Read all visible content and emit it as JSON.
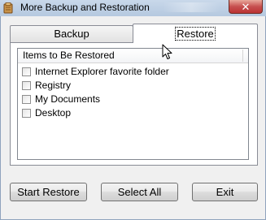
{
  "window": {
    "title": "More Backup and Restoration",
    "close_glyph": "✕"
  },
  "tabs": [
    {
      "label": "Backup",
      "active": false
    },
    {
      "label": "Restore",
      "active": true
    }
  ],
  "list": {
    "header": "Items to Be Restored",
    "items": [
      {
        "label": "Internet Explorer favorite folder",
        "checked": false
      },
      {
        "label": "Registry",
        "checked": false
      },
      {
        "label": "My Documents",
        "checked": false
      },
      {
        "label": "Desktop",
        "checked": false
      }
    ]
  },
  "buttons": {
    "start_restore": "Start Restore",
    "select_all": "Select All",
    "exit": "Exit"
  },
  "icons": {
    "app": "backup-app-icon",
    "close": "close-icon",
    "cursor": "mouse-cursor-icon"
  }
}
